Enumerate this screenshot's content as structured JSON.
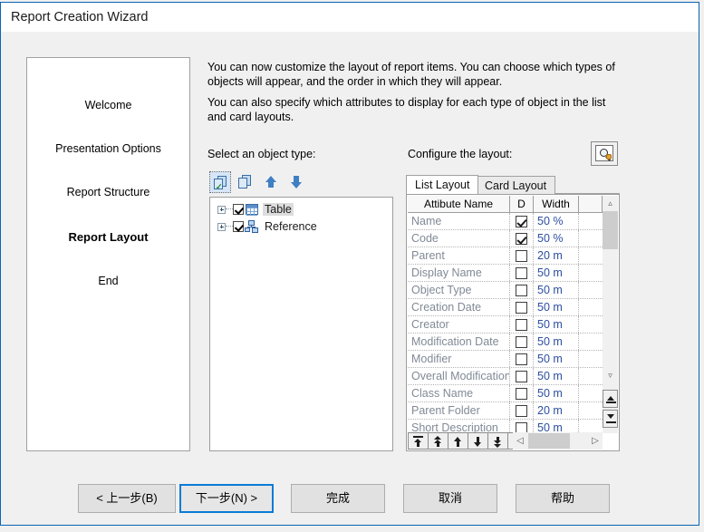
{
  "window": {
    "title": "Report Creation Wizard"
  },
  "nav": {
    "items": [
      {
        "label": "Welcome",
        "current": false
      },
      {
        "label": "Presentation Options",
        "current": false
      },
      {
        "label": "Report Structure",
        "current": false
      },
      {
        "label": "Report Layout",
        "current": true
      },
      {
        "label": "End",
        "current": false
      }
    ]
  },
  "intro": {
    "paragraph1": "You can now customize the layout of report items.\nYou can choose which types of objects will appear, and the order in which they will appear.",
    "paragraph2": "You can also specify which attributes to display for each type of object in the list and card layouts."
  },
  "labels": {
    "object_type": "Select an object type:",
    "configure_layout": "Configure the layout:"
  },
  "object_toolbar": {
    "buttons": [
      {
        "name": "select-all-icon",
        "selected": true
      },
      {
        "name": "deselect-all-icon",
        "selected": false
      },
      {
        "name": "move-up-icon",
        "selected": false
      },
      {
        "name": "move-down-icon",
        "selected": false
      }
    ]
  },
  "tree": {
    "items": [
      {
        "label": "Table",
        "checked": true,
        "expandable": true,
        "highlighted": true,
        "icon": "table-icon"
      },
      {
        "label": "Reference",
        "checked": true,
        "expandable": true,
        "highlighted": false,
        "icon": "reference-icon"
      }
    ]
  },
  "tabs": [
    {
      "label": "List Layout",
      "active": true
    },
    {
      "label": "Card Layout",
      "active": false
    }
  ],
  "grid": {
    "columns": [
      "Attibute Name",
      "D",
      "Width"
    ],
    "rows": [
      {
        "name": "Name",
        "display": true,
        "width": "50 %"
      },
      {
        "name": "Code",
        "display": true,
        "width": "50 %"
      },
      {
        "name": "Parent",
        "display": false,
        "width": "20 m"
      },
      {
        "name": "Display Name",
        "display": false,
        "width": "50 m"
      },
      {
        "name": "Object Type",
        "display": false,
        "width": "50 m"
      },
      {
        "name": "Creation Date",
        "display": false,
        "width": "50 m"
      },
      {
        "name": "Creator",
        "display": false,
        "width": "50 m"
      },
      {
        "name": "Modification Date",
        "display": false,
        "width": "50 m"
      },
      {
        "name": "Modifier",
        "display": false,
        "width": "50 m"
      },
      {
        "name": "Overall Modification",
        "display": false,
        "width": "50 m"
      },
      {
        "name": "Class Name",
        "display": false,
        "width": "50 m"
      },
      {
        "name": "Parent Folder",
        "display": false,
        "width": "20 m"
      },
      {
        "name": "Short Description",
        "display": false,
        "width": "50 m"
      }
    ]
  },
  "grid_toolbar": {
    "buttons": [
      "move-to-top-icon",
      "move-up-fast-icon",
      "move-up-icon",
      "move-down-icon",
      "move-down-fast-icon",
      "move-to-bottom-icon"
    ]
  },
  "footer": {
    "back": "< 上一步(B)",
    "next": "下一步(N) >",
    "finish": "完成",
    "cancel": "取消",
    "help": "帮助"
  },
  "colors": {
    "accent": "#0a7bd6",
    "window_border": "#0a64b4",
    "panel_bg": "#f0f0f0",
    "grid_value": "#2d4fa0",
    "grid_name": "#808a96"
  }
}
